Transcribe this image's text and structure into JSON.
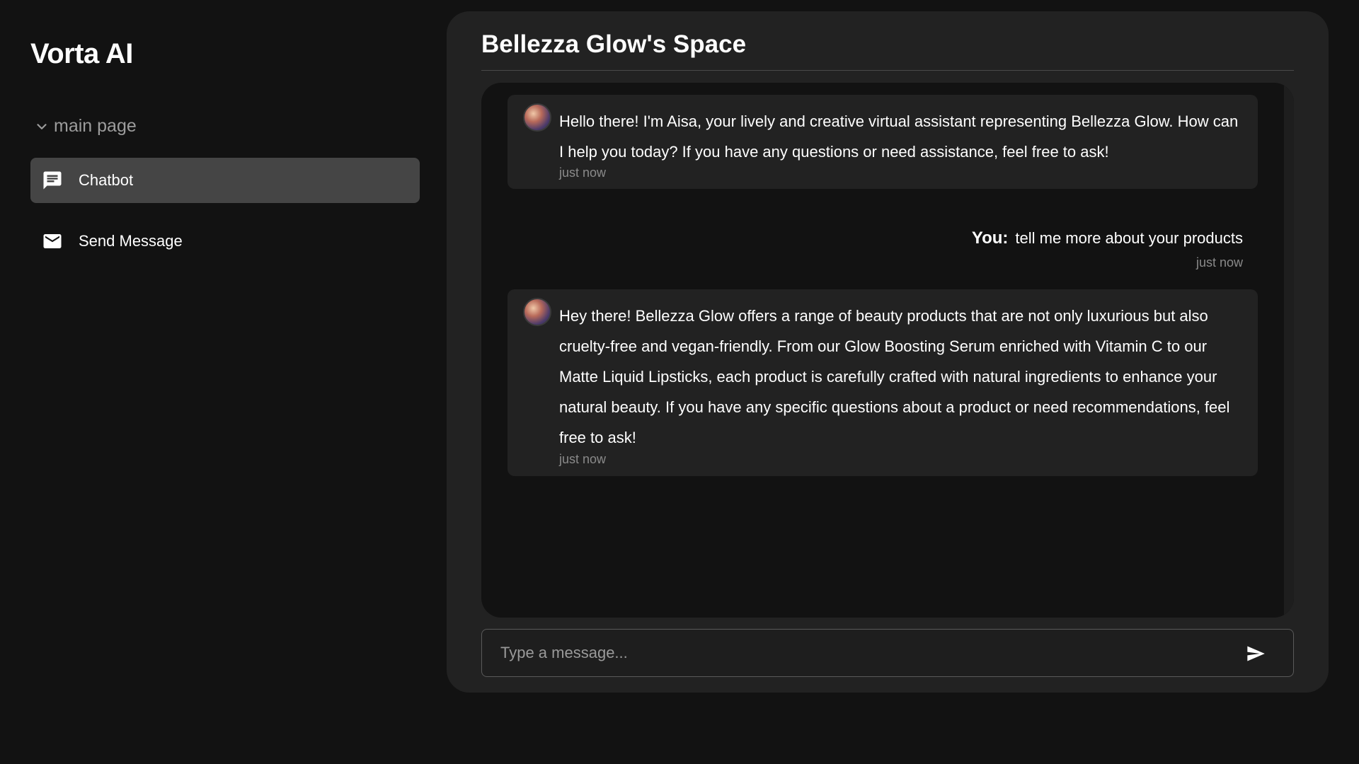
{
  "sidebar": {
    "app_title": "Vorta AI",
    "section_label": "main page",
    "items": [
      {
        "label": "Chatbot",
        "icon": "chat-icon",
        "active": true
      },
      {
        "label": "Send Message",
        "icon": "mail-icon",
        "active": false
      }
    ]
  },
  "chat": {
    "title": "Bellezza Glow's Space",
    "messages": [
      {
        "sender": "bot",
        "text": "Hello there! I'm Aisa, your lively and creative virtual assistant representing Bellezza Glow. How can I help you today? If you have any questions or need assistance, feel free to ask!",
        "time": "just now"
      },
      {
        "sender": "user",
        "label": "You:",
        "text": "tell me more about your products",
        "time": "just now"
      },
      {
        "sender": "bot",
        "text": "Hey there! Bellezza Glow offers a range of beauty products that are not only luxurious but also cruelty-free and vegan-friendly. From our Glow Boosting Serum enriched with Vitamin C to our Matte Liquid Lipsticks, each product is carefully crafted with natural ingredients to enhance your natural beauty. If you have any specific questions about a product or need recommendations, feel free to ask!",
        "time": "just now"
      }
    ],
    "input": {
      "placeholder": "Type a message...",
      "value": ""
    }
  },
  "colors": {
    "background": "#121212",
    "panel": "#222222",
    "active_item": "#454545",
    "muted_text": "#8a8a8a"
  }
}
